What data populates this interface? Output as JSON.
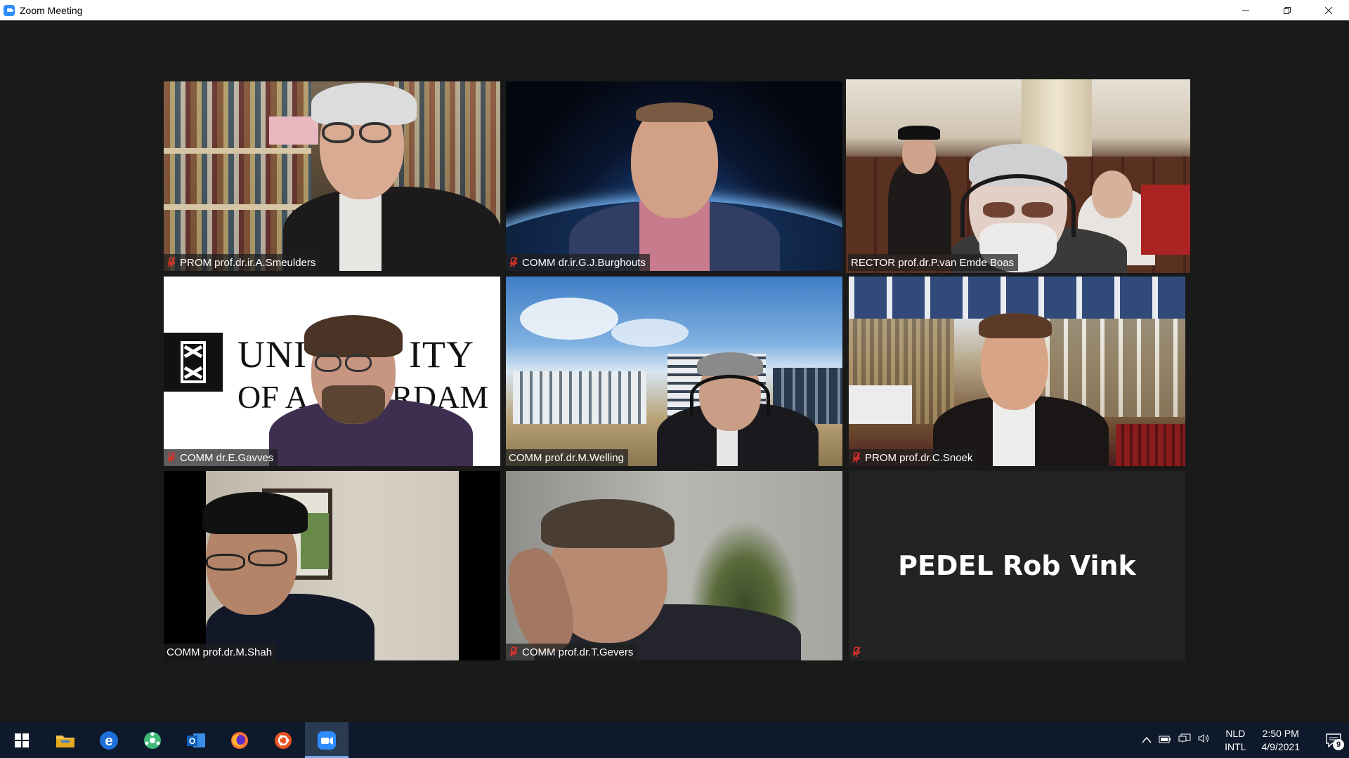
{
  "window": {
    "title": "Zoom Meeting"
  },
  "tiles": [
    {
      "label": "PROM prof.dr.ir.A.Smeulders",
      "muted": true,
      "active": false
    },
    {
      "label": "COMM dr.ir.G.J.Burghouts",
      "muted": true,
      "active": false
    },
    {
      "label": "RECTOR prof.dr.P.van Emde Boas",
      "muted": false,
      "active": true
    },
    {
      "label": "COMM dr.E.Gavves",
      "muted": true,
      "active": false,
      "bg_text_line1": "UNIV",
      "bg_text_line1b": "ITY",
      "bg_text_line2": "OF A",
      "bg_text_line2b": "ERDAM"
    },
    {
      "label": "COMM prof.dr.M.Welling",
      "muted": false,
      "active": false
    },
    {
      "label": "PROM prof.dr.C.Snoek",
      "muted": true,
      "active": false
    },
    {
      "label": "COMM prof.dr.M.Shah",
      "muted": false,
      "active": false
    },
    {
      "label": "COMM prof.dr.T.Gevers",
      "muted": true,
      "active": false
    },
    {
      "label": "",
      "muted": true,
      "active": false,
      "center_name": "PEDEL Rob Vink"
    }
  ],
  "taskbar": {
    "apps": [
      "start-icon",
      "file-explorer-icon",
      "edge-icon",
      "network-app-icon",
      "outlook-icon",
      "firefox-icon",
      "ubuntu-icon",
      "zoom-icon"
    ],
    "active_app": "zoom-icon"
  },
  "tray": {
    "lang_line1": "NLD",
    "lang_line2": "INTL",
    "time": "2:50 PM",
    "date": "4/9/2021",
    "notification_count": "9"
  },
  "colors": {
    "active_speaker_border": "#c8e86a",
    "mute_red": "#e0322b",
    "zoom_blue": "#2d8cff",
    "taskbar": "#0e1a2b"
  }
}
